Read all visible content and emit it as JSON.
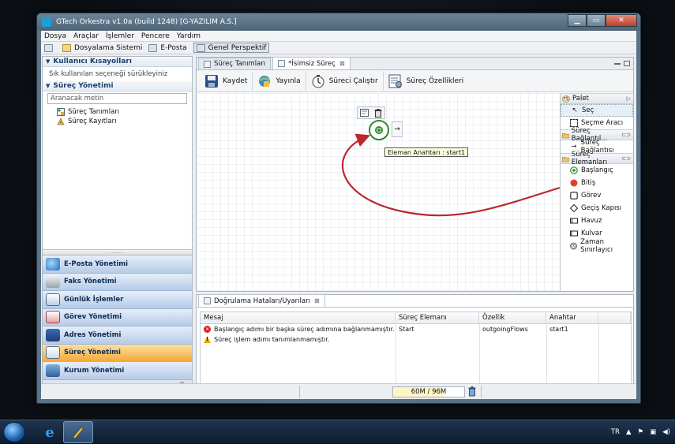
{
  "window": {
    "title": "GTech Orkestra v1.0a (build 1248) [G-YAZILIM A.S.]"
  },
  "menu": [
    "Dosya",
    "Araçlar",
    "İşlemler",
    "Pencere",
    "Yardım"
  ],
  "toolbar": {
    "items": [
      "Dosyalama Sistemi",
      "E-Posta",
      "Genel Perspektif"
    ]
  },
  "left": {
    "shortcuts_header": "Kullanıcı Kısayolları",
    "shortcuts_hint": "Sık kullanılan seçeneği sürükleyiniz",
    "process_header": "Süreç Yönetimi",
    "search_placeholder": "Aranacak metin",
    "tree": [
      "Süreç Tanımları",
      "Süreç Kayıtları"
    ],
    "splitter": "........",
    "nav": [
      "E-Posta Yönetimi",
      "Faks Yönetimi",
      "Günlük İşlemler",
      "Görev Yönetimi",
      "Adres Yönetimi",
      "Süreç Yönetimi",
      "Kurum Yönetimi"
    ]
  },
  "editor": {
    "tabs": [
      "Süreç Tanımları",
      "*İsimsiz Süreç"
    ],
    "tab_close": "⊠",
    "actions": [
      "Kaydet",
      "Yayınla",
      "Süreci Çalıştır",
      "Süreç Özellikleri"
    ],
    "tooltip": "Eleman Anahtarı : start1",
    "arrow_glyph": "→"
  },
  "palette": {
    "header": "Palet",
    "tools": [
      "Seç",
      "Seçme Aracı"
    ],
    "connections_header": "Süreç Bağlantıl...",
    "connections": [
      "Süreç Bağlantısı"
    ],
    "elements_header": "Süreç Elemanları",
    "elements": [
      "Başlangıç",
      "Bitiş",
      "Görev",
      "Geçiş Kapısı",
      "Havuz",
      "Kulvar",
      "Zaman Sınırlayıcı"
    ]
  },
  "validation": {
    "tab": "Doğrulama Hataları/Uyarıları",
    "tab_close": "⊠",
    "columns": [
      "Mesaj",
      "Süreç Elemanı",
      "Özellik",
      "Anahtar"
    ],
    "rows": [
      {
        "type": "error",
        "message": "Başlangıç adımı bir başka süreç adımına bağlanmamıştır.",
        "element": "Start",
        "property": "outgoingFlows",
        "key": "start1"
      },
      {
        "type": "warning",
        "message": "Süreç işlem adımı tanımlanmamıştır.",
        "element": "",
        "property": "",
        "key": ""
      }
    ]
  },
  "status": {
    "memory": "60M / 96M"
  },
  "taskbar": {
    "lang": "TR"
  },
  "colors": {
    "accent": "#f5a83a",
    "start_node": "#2b8a2b",
    "flow_arrow": "#c0262d"
  }
}
